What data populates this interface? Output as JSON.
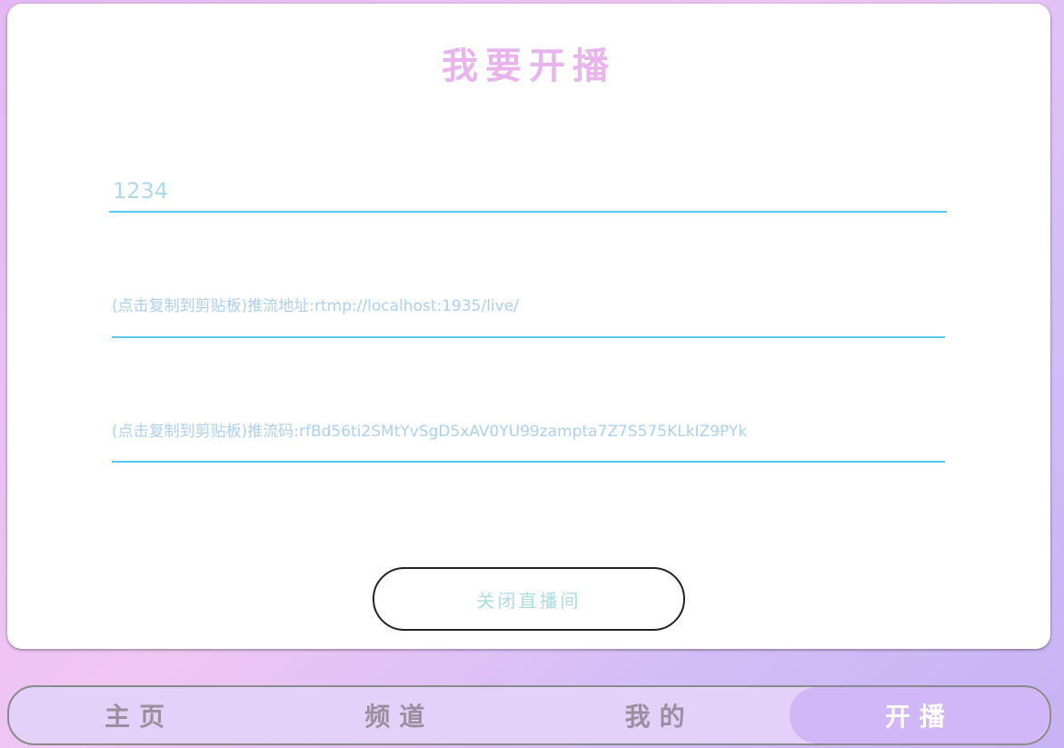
{
  "page": {
    "title": "我要开播"
  },
  "form": {
    "room_name_value": "1234",
    "push_url_text": "(点击复制到剪贴板)推流地址:rtmp://localhost:1935/live/",
    "stream_key_text": "(点击复制到剪贴板)推流码:rfBd56ti2SMtYvSgD5xAV0YU99zampta7Z7S575KLkIZ9PYk",
    "close_button_label": "关闭直播间"
  },
  "bottom_nav": {
    "items": [
      {
        "label": "主页",
        "active": false
      },
      {
        "label": "频道",
        "active": false
      },
      {
        "label": "我的",
        "active": false
      },
      {
        "label": "开播",
        "active": true
      }
    ]
  },
  "colors": {
    "title": "#e9b4ec",
    "field_underline": "#58c8ef",
    "field_text": "#acd0ee",
    "nav_background": "#e3d1fa",
    "nav_active": "#d2b7f8"
  }
}
